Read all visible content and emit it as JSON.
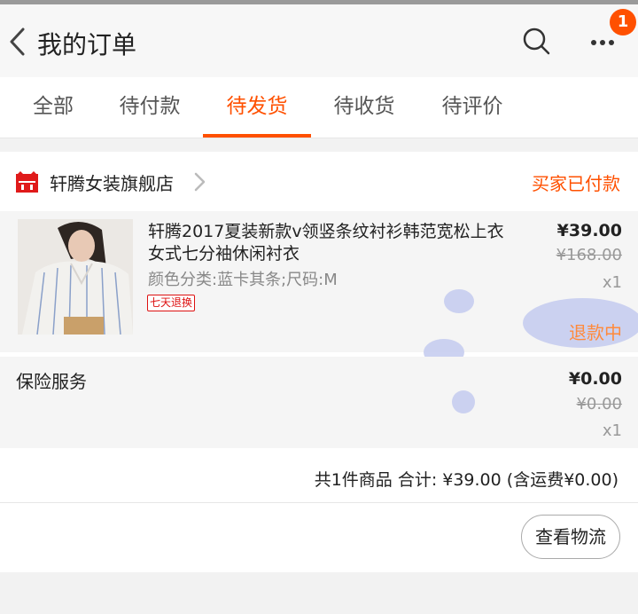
{
  "header": {
    "title": "我的订单",
    "back_icon": "chevron-left-icon",
    "search_icon": "search-icon",
    "more_icon": "more-dots-icon",
    "badge_count": "1"
  },
  "tabs": [
    {
      "label": "全部"
    },
    {
      "label": "待付款"
    },
    {
      "label": "待发货",
      "active": true
    },
    {
      "label": "待收货"
    },
    {
      "label": "待评价"
    }
  ],
  "order": {
    "shop_icon": "tmall-icon",
    "shop_name": "轩腾女装旗舰店",
    "status": "买家已付款",
    "item": {
      "title": "轩腾2017夏装新款v领竖条纹衬衫韩范宽松上衣女式七分袖休闲衬衣",
      "spec": "颜色分类:蓝卡其条;尺码:M",
      "tag": "七天退换",
      "price": "¥39.00",
      "original_price": "¥168.00",
      "quantity": "x1",
      "refund_status": "退款中"
    },
    "insurance": {
      "label": "保险服务",
      "price": "¥0.00",
      "original_price": "¥0.00",
      "quantity": "x1"
    },
    "summary": "共1件商品  合计: ¥39.00 (含运费¥0.00)",
    "logistics_button": "查看物流"
  },
  "colors": {
    "accent": "#ff5000",
    "refund_text": "#ff8a3c",
    "badge": "#ff5000"
  }
}
